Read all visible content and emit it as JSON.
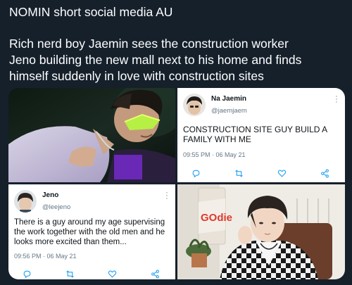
{
  "caption": {
    "title": "NOMIN short social media AU",
    "line1": "Rich nerd boy Jaemin sees the construction worker",
    "line2": "Jeno building the new mall next to his home and finds",
    "line3": "himself suddenly in love with construction sites"
  },
  "tweets": [
    {
      "name": "Na Jaemin",
      "handle": "@jaemjaem",
      "text": "CONSTRUCTION SITE GUY BUILD A FAMILY WITH ME",
      "time": "09:55 PM · 06 May 21"
    },
    {
      "name": "Jeno",
      "handle": "@leejeno",
      "text": "There is a guy around my age supervising the work together with the old men and he looks more excited than them...",
      "time": "09:56 PM · 06 May 21"
    }
  ],
  "photo_sign_text": "GOdie",
  "colors": {
    "background": "#15202b",
    "tweet_bg": "#ffffff",
    "icon_blue": "#1da1f2",
    "muted": "#657786"
  },
  "icons": [
    "reply-icon",
    "retweet-icon",
    "like-icon",
    "share-icon",
    "more-icon"
  ]
}
